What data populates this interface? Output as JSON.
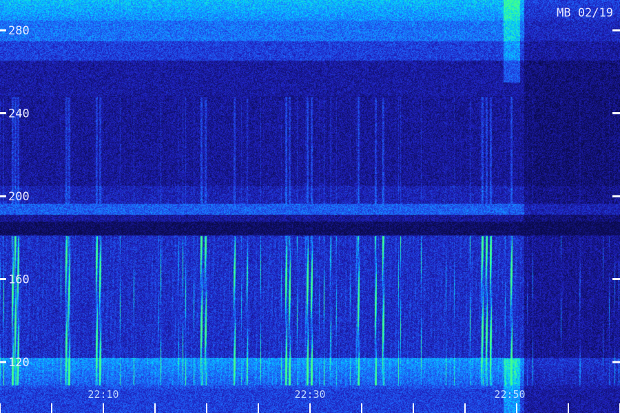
{
  "chart_data": {
    "type": "heatmap",
    "title": "",
    "xlabel": "",
    "ylabel": "",
    "corner_label": "MB 02/19",
    "y_ticks": [
      "280",
      "240",
      "200",
      "160",
      "120"
    ],
    "y_tick_values": [
      280,
      240,
      200,
      160,
      120
    ],
    "ylim": [
      104,
      288
    ],
    "x_ticks": [
      "22:10",
      "22:30",
      "22:50"
    ],
    "grid": false,
    "colormap": [
      "#0a0a4a",
      "#2020c0",
      "#1e6cff",
      "#00d0ff",
      "#40ff90"
    ]
  }
}
